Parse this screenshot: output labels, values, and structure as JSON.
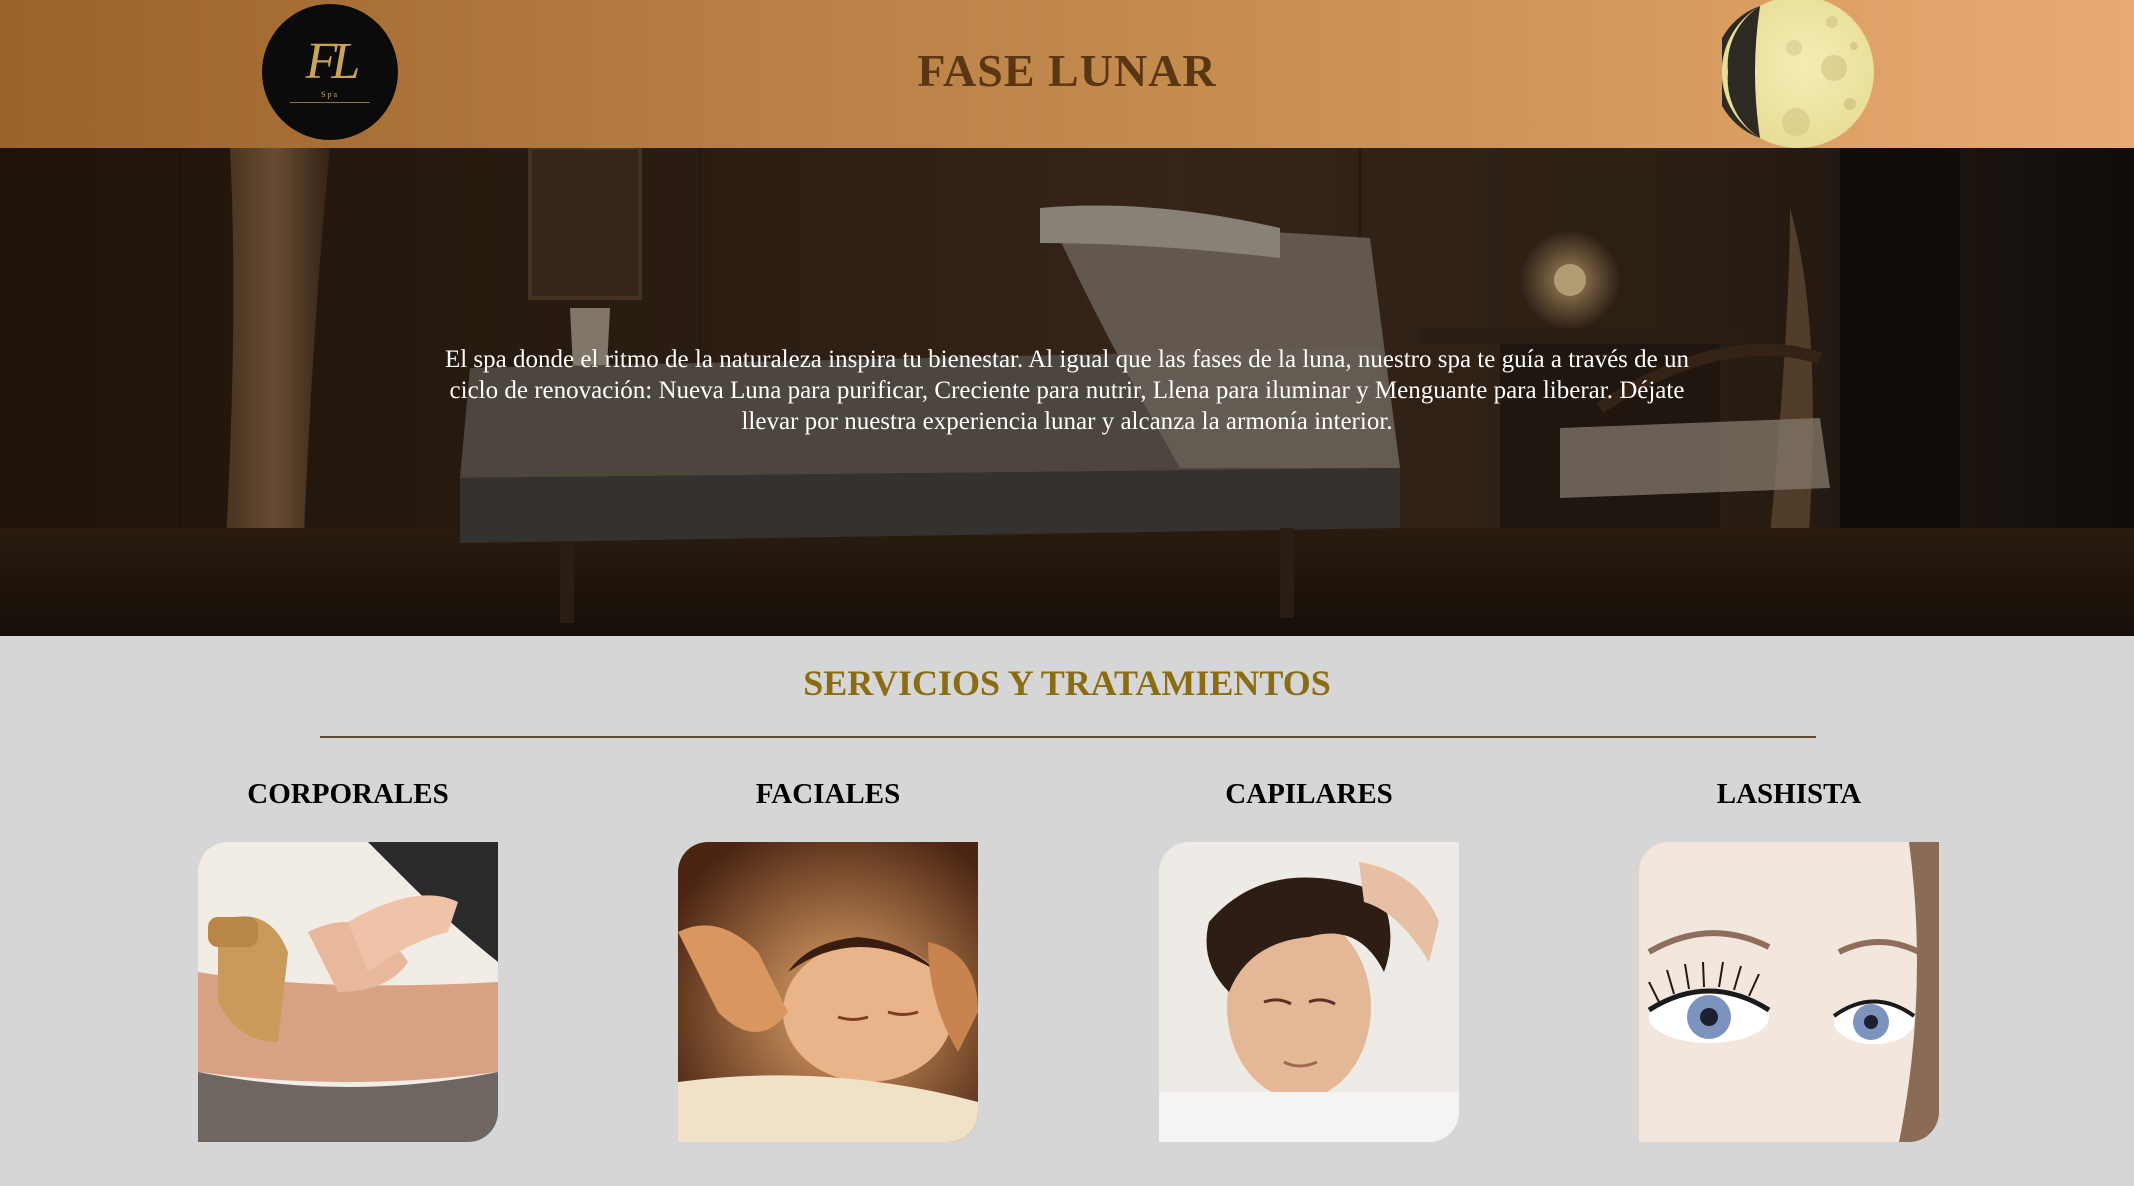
{
  "header": {
    "title": "FASE LUNAR",
    "logo": {
      "monogram": "FL",
      "subtitle": "Spa",
      "icon": "fase-lunar-logo"
    },
    "moon_icon": "crescent-moon-icon"
  },
  "hero": {
    "text": "El spa donde el ritmo de la naturaleza inspira tu bienestar. Al igual que las fases de la luna, nuestro spa te guía a través de un ciclo de renovación: Nueva Luna para purificar, Creciente para nutrir, Llena para iluminar y Menguante para liberar. Déjate llevar por nuestra experiencia lunar y alcanza la armonía interior.",
    "image": "spa-massage-room-photo"
  },
  "services": {
    "title": "SERVICIOS Y TRATAMIENTOS",
    "items": [
      {
        "name": "CORPORALES",
        "image": "body-massage-photo"
      },
      {
        "name": "FACIALES",
        "image": "facial-massage-photo"
      },
      {
        "name": "CAPILARES",
        "image": "scalp-massage-photo"
      },
      {
        "name": "LASHISTA",
        "image": "eyelashes-photo"
      }
    ]
  },
  "colors": {
    "header_start": "#9a6328",
    "header_end": "#eaab72",
    "title_brown": "#5a3712",
    "services_gold": "#8a6c12",
    "page_background": "#d6d6d6"
  }
}
